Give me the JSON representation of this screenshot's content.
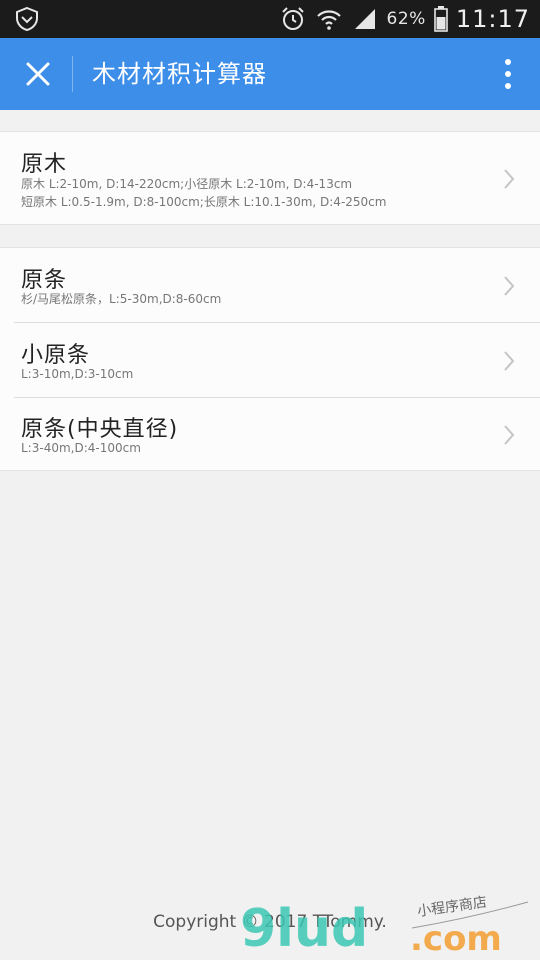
{
  "status_bar": {
    "battery_percent": "62%",
    "time": "11:17"
  },
  "app_bar": {
    "title": "木材材积计算器",
    "close_icon": "close-icon",
    "more_icon": "more-vertical-icon",
    "background": "#3d8ee8"
  },
  "groups": [
    {
      "items": [
        {
          "title": "原木",
          "lines": [
            "原木 L:2-10m, D:14-220cm;小径原木 L:2-10m, D:4-13cm",
            "短原木 L:0.5-1.9m, D:8-100cm;长原木 L:10.1-30m, D:4-250cm"
          ]
        }
      ]
    },
    {
      "items": [
        {
          "title": "原条",
          "lines": [
            "杉/马尾松原条，L:5-30m,D:8-60cm"
          ]
        },
        {
          "title": "小原条",
          "lines": [
            "L:3-10m,D:3-10cm"
          ]
        },
        {
          "title": "原条(中央直径)",
          "lines": [
            "L:3-40m,D:4-100cm"
          ]
        }
      ]
    }
  ],
  "footer": {
    "copyright": "Copyright © 2017 TTommy."
  },
  "watermark": {
    "brand": "9lud",
    "domain": ".com",
    "caption": "小程序商店"
  }
}
